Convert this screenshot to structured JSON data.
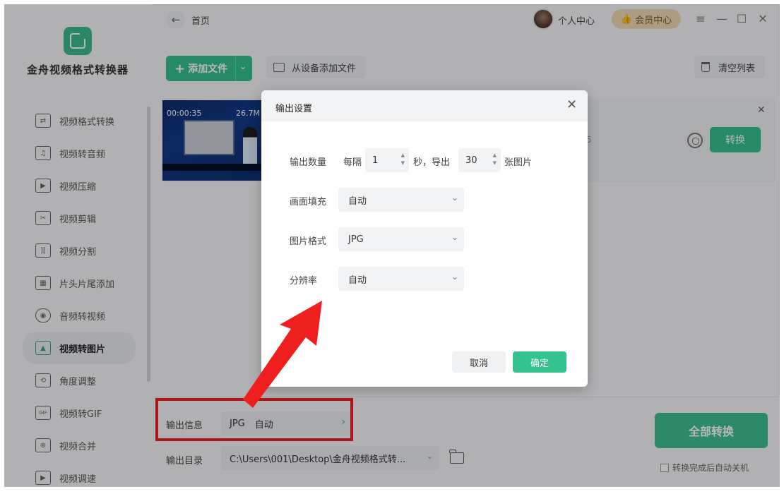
{
  "app": {
    "name": "金舟视频格式转换器"
  },
  "topbar": {
    "back_icon": "arrow-left-icon",
    "breadcrumb": "首页",
    "profile_label": "个人中心",
    "member_label": "会员中心",
    "window_controls": [
      "≡",
      "—",
      "☐",
      "✕"
    ]
  },
  "sidebar": {
    "items": [
      {
        "label": "视频格式转换",
        "icon": "convert-icon",
        "active": false
      },
      {
        "label": "视频转音频",
        "icon": "music-note-icon",
        "active": false
      },
      {
        "label": "视频压缩",
        "icon": "compress-icon",
        "active": false
      },
      {
        "label": "视频剪辑",
        "icon": "scissors-icon",
        "active": false
      },
      {
        "label": "视频分割",
        "icon": "split-icon",
        "active": false
      },
      {
        "label": "片头片尾添加",
        "icon": "film-icon",
        "active": false
      },
      {
        "label": "音频转视频",
        "icon": "disc-icon",
        "active": false
      },
      {
        "label": "视频转图片",
        "icon": "image-icon",
        "active": true
      },
      {
        "label": "角度调整",
        "icon": "rotate-icon",
        "active": false
      },
      {
        "label": "视频转GIF",
        "icon": "gif-icon",
        "active": false
      },
      {
        "label": "视频合并",
        "icon": "merge-icon",
        "active": false
      },
      {
        "label": "视频调速",
        "icon": "speed-icon",
        "active": false
      }
    ]
  },
  "toolbar": {
    "add_file_label": "添加文件",
    "add_from_device_label": "从设备添加文件",
    "clear_list_label": "清空列表"
  },
  "file_item": {
    "duration": "00:00:35",
    "size": "26.7M",
    "hint_fragment": "5",
    "convert_label": "转换"
  },
  "bottom": {
    "output_info_label": "输出信息",
    "output_format": "JPG",
    "output_mode": "自动",
    "output_dir_label": "输出目录",
    "output_dir_value": "C:\\Users\\001\\Desktop\\金舟视频格式转...",
    "convert_all_label": "全部转换",
    "auto_shutdown_label": "转换完成后自动关机",
    "auto_shutdown_checked": false
  },
  "dialog": {
    "title": "输出设置",
    "output_count_label": "输出数量",
    "every_label": "每隔",
    "interval_value": "1",
    "seconds_export_label": "秒，导出",
    "count_value": "30",
    "images_label": "张图片",
    "fill_label": "画面填充",
    "fill_value": "自动",
    "format_label": "图片格式",
    "format_value": "JPG",
    "resolution_label": "分辨率",
    "resolution_value": "自动",
    "cancel_label": "取消",
    "ok_label": "确定"
  },
  "colors": {
    "accent": "#35c08e",
    "member_bg": "#f1d9b4",
    "highlight_red": "#f01f1f"
  }
}
